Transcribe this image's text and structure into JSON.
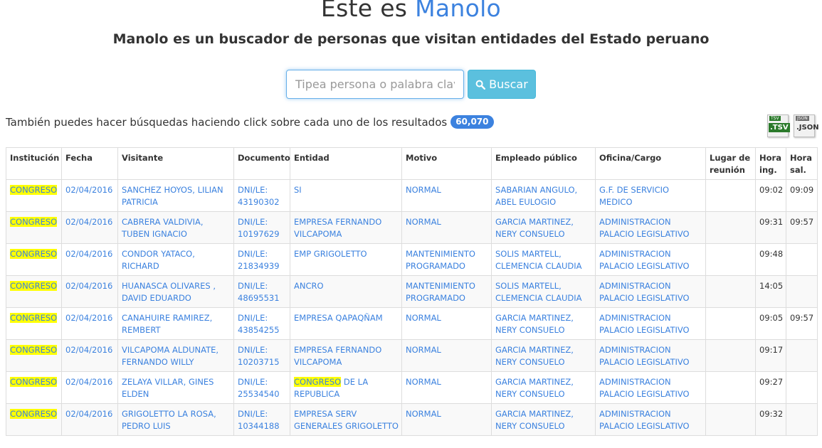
{
  "header": {
    "title_prefix": "Este es",
    "title_brand": "Manolo",
    "subtitle": "Manolo es un buscador de personas que visitan entidades del Estado peruano"
  },
  "search": {
    "placeholder": "Tipea persona o palabra clave",
    "value": "",
    "button_label": "Buscar"
  },
  "results_info": {
    "hint": "También puedes hacer búsquedas haciendo click sobre cada uno de los resultados",
    "count": "60,070"
  },
  "downloads": {
    "tsv": {
      "tag": "TSV",
      "label": ".TSV"
    },
    "json": {
      "tag": "JSON",
      "label": ".JSON"
    }
  },
  "colors": {
    "accent": "#3c82df",
    "button": "#5bc0de",
    "highlight": "#ffff00"
  },
  "table": {
    "headers": [
      "Institución",
      "Fecha",
      "Visitante",
      "Documento",
      "Entidad",
      "Motivo",
      "Empleado público",
      "Oficina/Cargo",
      "Lugar de reunión",
      "Hora ing.",
      "Hora sal."
    ],
    "rows": [
      {
        "institucion": "CONGRESO",
        "fecha": "02/04/2016",
        "visitante": "SANCHEZ HOYOS, LILIAN PATRICIA",
        "documento": "DNI/LE: 43190302",
        "entidad_pre": "",
        "entidad_hl": "",
        "entidad_post": "SI",
        "motivo": "NORMAL",
        "empleado": "SABARIAN ANGULO, ABEL EULOGIO",
        "oficina": "G.F. DE SERVICIO MEDICO",
        "lugar": "",
        "hora_ing": "09:02",
        "hora_sal": "09:09"
      },
      {
        "institucion": "CONGRESO",
        "fecha": "02/04/2016",
        "visitante": "CABRERA VALDIVIA, TUBEN IGNACIO",
        "documento": "DNI/LE: 10197629",
        "entidad_pre": "",
        "entidad_hl": "",
        "entidad_post": "EMPRESA FERNANDO VILCAPOMA",
        "motivo": "NORMAL",
        "empleado": "GARCIA MARTINEZ, NERY CONSUELO",
        "oficina": "ADMINISTRACION PALACIO LEGISLATIVO",
        "lugar": "",
        "hora_ing": "09:31",
        "hora_sal": "09:57"
      },
      {
        "institucion": "CONGRESO",
        "fecha": "02/04/2016",
        "visitante": "CONDOR YATACO, RICHARD",
        "documento": "DNI/LE: 21834939",
        "entidad_pre": "",
        "entidad_hl": "",
        "entidad_post": "EMP GRIGOLETTO",
        "motivo": "MANTENIMIENTO PROGRAMADO",
        "empleado": "SOLIS MARTELL, CLEMENCIA CLAUDIA",
        "oficina": "ADMINISTRACION PALACIO LEGISLATIVO",
        "lugar": "",
        "hora_ing": "09:48",
        "hora_sal": ""
      },
      {
        "institucion": "CONGRESO",
        "fecha": "02/04/2016",
        "visitante": "HUANASCA OLIVARES , DAVID EDUARDO",
        "documento": "DNI/LE: 48695531",
        "entidad_pre": "",
        "entidad_hl": "",
        "entidad_post": "ANCRO",
        "motivo": "MANTENIMIENTO PROGRAMADO",
        "empleado": "SOLIS MARTELL, CLEMENCIA CLAUDIA",
        "oficina": "ADMINISTRACION PALACIO LEGISLATIVO",
        "lugar": "",
        "hora_ing": "14:05",
        "hora_sal": ""
      },
      {
        "institucion": "CONGRESO",
        "fecha": "02/04/2016",
        "visitante": "CANAHUIRE RAMIREZ, REMBERT",
        "documento": "DNI/LE: 43854255",
        "entidad_pre": "",
        "entidad_hl": "",
        "entidad_post": "EMPRESA QAPAQÑAM",
        "motivo": "NORMAL",
        "empleado": "GARCIA MARTINEZ, NERY CONSUELO",
        "oficina": "ADMINISTRACION PALACIO LEGISLATIVO",
        "lugar": "",
        "hora_ing": "09:05",
        "hora_sal": "09:57"
      },
      {
        "institucion": "CONGRESO",
        "fecha": "02/04/2016",
        "visitante": "VILCAPOMA ALDUNATE, FERNANDO WILLY",
        "documento": "DNI/LE: 10203715",
        "entidad_pre": "",
        "entidad_hl": "",
        "entidad_post": "EMPRESA FERNANDO VILCAPOMA",
        "motivo": "NORMAL",
        "empleado": "GARCIA MARTINEZ, NERY CONSUELO",
        "oficina": "ADMINISTRACION PALACIO LEGISLATIVO",
        "lugar": "",
        "hora_ing": "09:17",
        "hora_sal": ""
      },
      {
        "institucion": "CONGRESO",
        "fecha": "02/04/2016",
        "visitante": "ZELAYA VILLAR, GINES ELDEN",
        "documento": "DNI/LE: 25534540",
        "entidad_pre": "",
        "entidad_hl": "CONGRESO",
        "entidad_post": " DE LA REPUBLICA",
        "motivo": "NORMAL",
        "empleado": "GARCIA MARTINEZ, NERY CONSUELO",
        "oficina": "ADMINISTRACION PALACIO LEGISLATIVO",
        "lugar": "",
        "hora_ing": "09:27",
        "hora_sal": ""
      },
      {
        "institucion": "CONGRESO",
        "fecha": "02/04/2016",
        "visitante": "GRIGOLETTO LA ROSA, PEDRO LUIS",
        "documento": "DNI/LE: 10344188",
        "entidad_pre": "",
        "entidad_hl": "",
        "entidad_post": "EMPRESA SERV GENERALES GRIGOLETTO",
        "motivo": "NORMAL",
        "empleado": "GARCIA MARTINEZ, NERY CONSUELO",
        "oficina": "ADMINISTRACION PALACIO LEGISLATIVO",
        "lugar": "",
        "hora_ing": "09:32",
        "hora_sal": ""
      }
    ]
  }
}
